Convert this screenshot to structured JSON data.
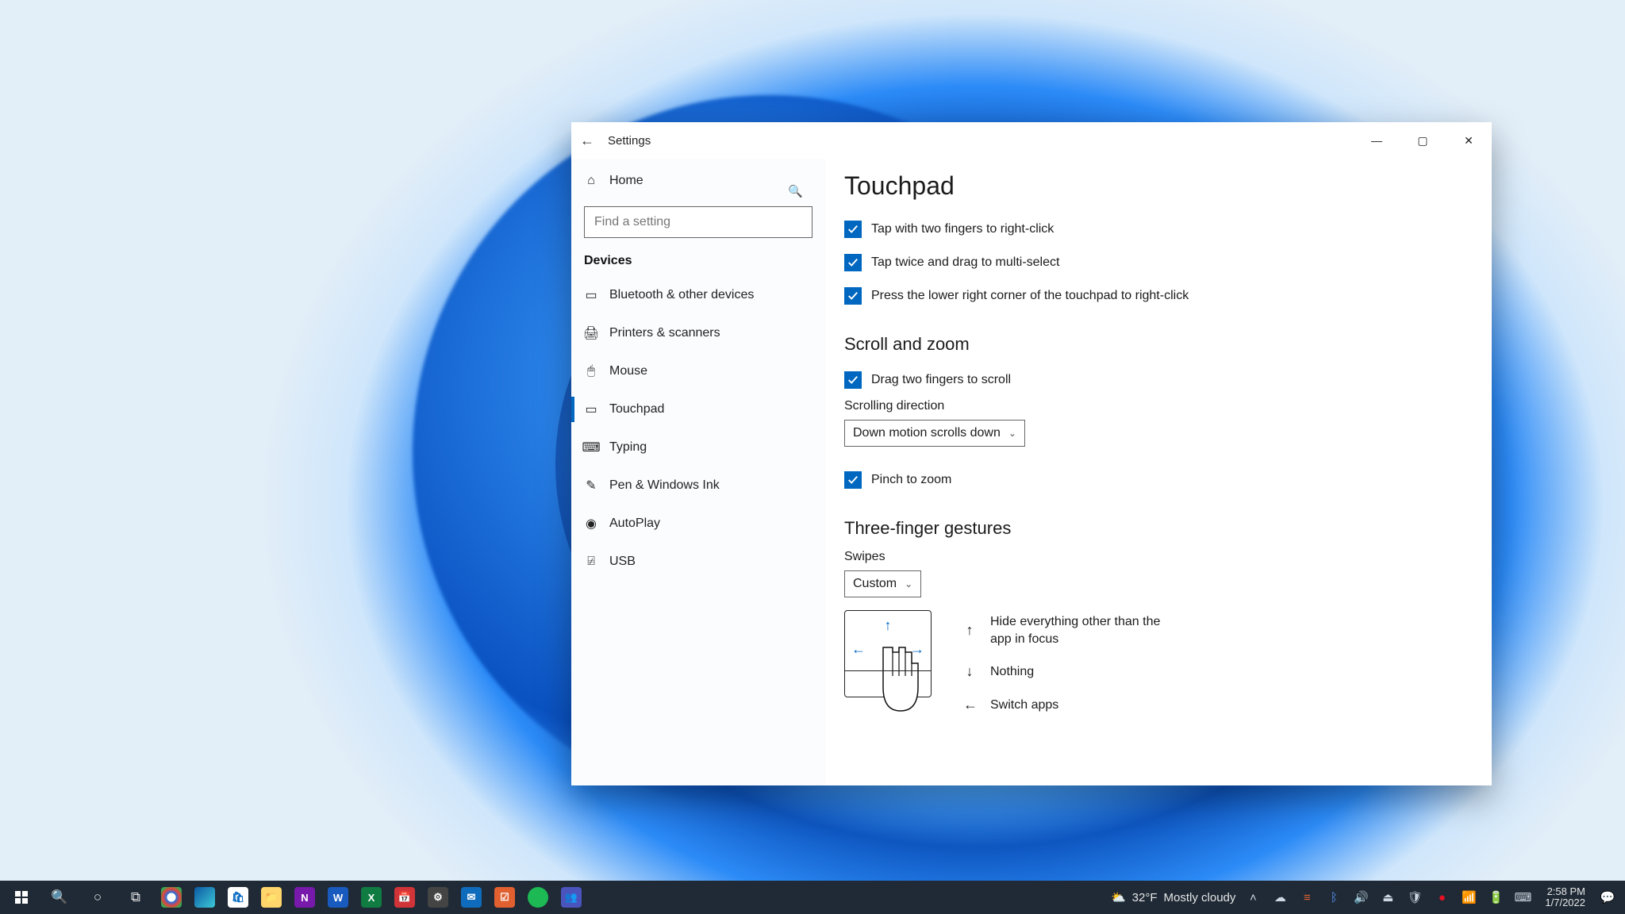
{
  "window": {
    "title": "Settings"
  },
  "sidebar": {
    "home": "Home",
    "search_placeholder": "Find a setting",
    "section": "Devices",
    "items": [
      {
        "label": "Bluetooth & other devices",
        "icon": "bluetooth-devices-icon"
      },
      {
        "label": "Printers & scanners",
        "icon": "printer-icon"
      },
      {
        "label": "Mouse",
        "icon": "mouse-icon"
      },
      {
        "label": "Touchpad",
        "icon": "touchpad-icon",
        "selected": true
      },
      {
        "label": "Typing",
        "icon": "keyboard-icon"
      },
      {
        "label": "Pen & Windows Ink",
        "icon": "pen-icon"
      },
      {
        "label": "AutoPlay",
        "icon": "autoplay-icon"
      },
      {
        "label": "USB",
        "icon": "usb-icon"
      }
    ]
  },
  "content": {
    "title": "Touchpad",
    "tap_checks": [
      {
        "label": "Tap with two fingers to right-click",
        "checked": true
      },
      {
        "label": "Tap twice and drag to multi-select",
        "checked": true
      },
      {
        "label": "Press the lower right corner of the touchpad to right-click",
        "checked": true
      }
    ],
    "scroll_zoom": {
      "heading": "Scroll and zoom",
      "drag_label": "Drag two fingers to scroll",
      "direction_label": "Scrolling direction",
      "direction_value": "Down motion scrolls down",
      "pinch_label": "Pinch to zoom"
    },
    "gestures": {
      "heading": "Three-finger gestures",
      "swipes_label": "Swipes",
      "swipes_value": "Custom",
      "up": "Hide everything other than the app in focus",
      "down": "Nothing",
      "left": "Switch apps"
    }
  },
  "taskbar": {
    "weather": {
      "temp": "32°F",
      "cond": "Mostly cloudy"
    },
    "clock": {
      "time": "2:58 PM",
      "date": "1/7/2022"
    }
  }
}
